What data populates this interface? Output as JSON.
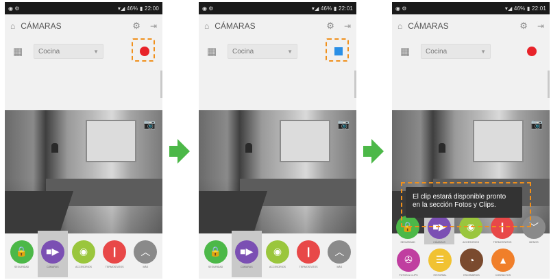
{
  "status_bar": {
    "time_1": "22:00",
    "time_2": "22:01",
    "time_3": "22:01",
    "signal": "46%"
  },
  "app": {
    "title": "CÁMARAS"
  },
  "camera_select": {
    "value": "Cocina"
  },
  "toast": {
    "line1": "El clip estará disponible pronto",
    "line2": "en la sección Fotos y Clips."
  },
  "dock": [
    {
      "label": "SEGURIDAD",
      "color": "#4cb848",
      "icon": "lock-icon"
    },
    {
      "label": "CÁMARAS",
      "color": "#7b4fb3",
      "icon": "video-camera-icon"
    },
    {
      "label": "ACCESORIOS",
      "color": "#9ac63d",
      "icon": "wifi-icon"
    },
    {
      "label": "TERMOSTATOS",
      "color": "#e84848",
      "icon": "thermometer-icon"
    },
    {
      "label": "MÁS",
      "color": "#8a8a8a",
      "icon": "chevron-up-icon"
    }
  ],
  "grid_menu": [
    {
      "label": "SEGURIDAD",
      "color": "#4cb848",
      "icon": "lock-icon"
    },
    {
      "label": "CÁMARAS",
      "color": "#7b4fb3",
      "icon": "video-camera-icon"
    },
    {
      "label": "ACCESORIOS",
      "color": "#9ac63d",
      "icon": "wifi-icon"
    },
    {
      "label": "TERMOSTATOS",
      "color": "#e84848",
      "icon": "thermometer-icon"
    },
    {
      "label": "MENOS",
      "color": "#8a8a8a",
      "icon": "chevron-down-icon"
    },
    {
      "label": "FOTOS & CLIPS",
      "color": "#c03ea0",
      "icon": "film-reel-icon"
    },
    {
      "label": "HISTORIAL",
      "color": "#f1c232",
      "icon": "list-icon"
    },
    {
      "label": "ESCENARIOS",
      "color": "#7a4a2e",
      "icon": "scenes-icon"
    },
    {
      "label": "CONTACTOS",
      "color": "#f07f2a",
      "icon": "contacts-icon"
    }
  ],
  "colors": {
    "accent_orange": "#f0901c",
    "arrow_green": "#4cb848",
    "record_red": "#e8232a",
    "stop_blue": "#2a8fe6"
  }
}
